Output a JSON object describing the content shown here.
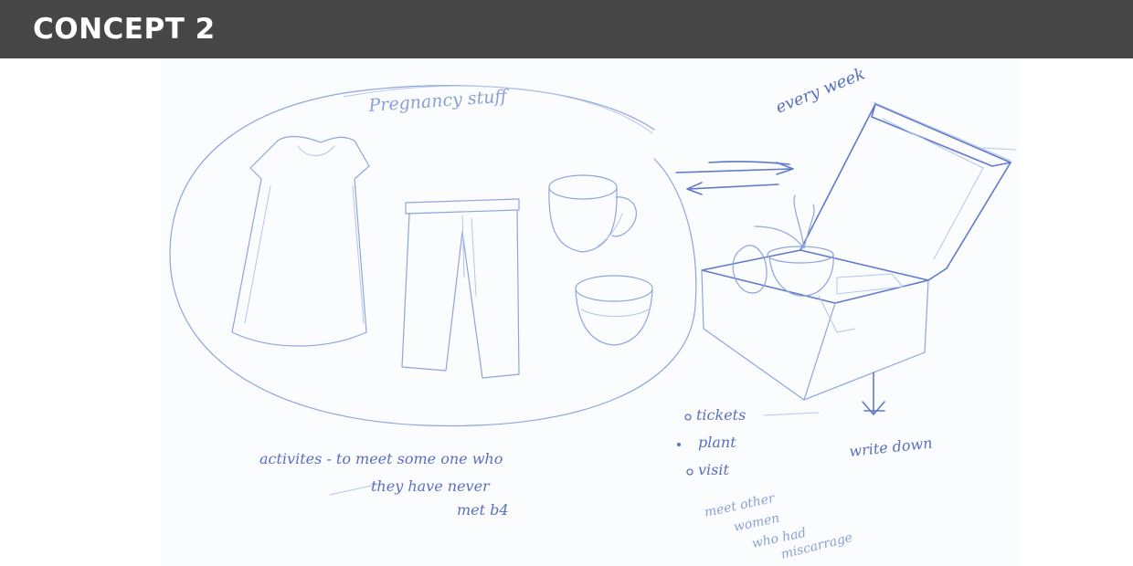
{
  "header": {
    "title": "CONCEPT 2"
  },
  "sketch": {
    "bubble_label": "Pregnancy stuff",
    "frequency_note": "every week",
    "box_contents": [
      "tickets",
      "plant",
      "visit"
    ],
    "activities_note": [
      "activites - to meet some one who",
      "they have never",
      "met b4"
    ],
    "arrow_note": "write down",
    "women_note": [
      "meet other",
      "women",
      "who had",
      "miscarrage"
    ],
    "colors": {
      "header_bg": "#464646",
      "pencil_blue": "#5a6fc0"
    }
  }
}
